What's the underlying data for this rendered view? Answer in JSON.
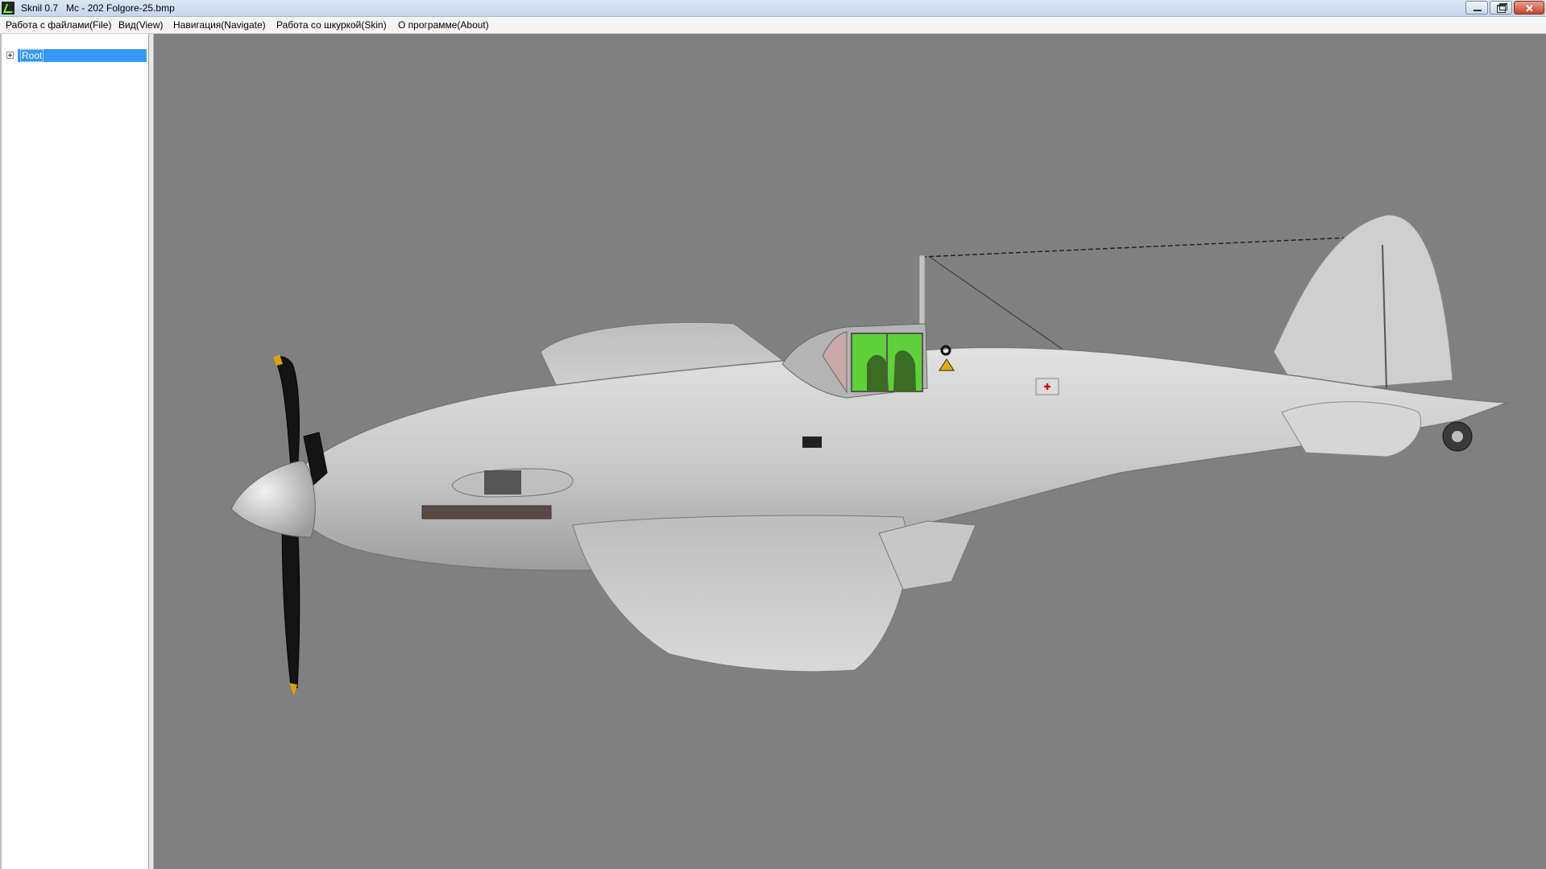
{
  "window": {
    "title": "Sknil 0.7   Mc - 202 Folgore-25.bmp",
    "icon": "app-icon"
  },
  "menu": {
    "items": [
      {
        "label": "Работа с файлами(File)"
      },
      {
        "label": "Вид(View)"
      },
      {
        "label": "Навигация(Navigate)"
      },
      {
        "label": "Работа со шкуркой(Skin)"
      },
      {
        "label": "О программе(About)"
      }
    ]
  },
  "tree": {
    "root_label": "Root",
    "expander_icon": "plus-expander-icon"
  },
  "viewport": {
    "background_color": "#808080",
    "model_description": "3D model of an aircraft rendered in light grey with green glazed cockpit canopy"
  },
  "colors": {
    "selection": "#3399ff",
    "canopy": "#5ed13a",
    "body": "#c9c9c9"
  }
}
